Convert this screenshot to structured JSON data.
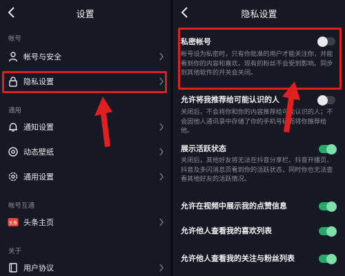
{
  "left": {
    "title": "设置",
    "sections": [
      {
        "label": "帐号"
      },
      {
        "label": "通用"
      },
      {
        "label": "帐号互通"
      },
      {
        "label": "关于"
      }
    ],
    "items": [
      {
        "label": "帐号与安全",
        "icon": "user-icon"
      },
      {
        "label": "隐私设置",
        "icon": "lock-icon"
      },
      {
        "label": "通知设置",
        "icon": "bell-icon"
      },
      {
        "label": "动态壁纸",
        "icon": "wallpaper-icon"
      },
      {
        "label": "通用设置",
        "icon": "gear-icon"
      },
      {
        "label": "头条主页",
        "icon": "toutiao-logo-icon",
        "badge": "头条"
      },
      {
        "label": "用户协议",
        "icon": "book-icon"
      }
    ]
  },
  "right": {
    "title": "隐私设置",
    "settings": [
      {
        "title": "私密帐号",
        "desc": "帐号设为私密时，只有你批准的用户才能关注你，并能看到你的内容和喜欢。现有的粉丝不会受到影响。同步到其他软件的开关会关闭。",
        "state": "off"
      },
      {
        "title": "允许将我推荐给可能认识的人",
        "desc": "关闭后，不会将你和你的内容推荐给可能认识的人；不会因他人通讯录中存储了你的手机号码而将你推荐给他。",
        "state": "off"
      },
      {
        "title": "展示活跃状态",
        "desc": "关闭后，其他好友将无法在抖音分享栏、抖音开播页、抖音及多闪消息页看到你的活跃状态，同时你也无法查看其他好友的活跃情况。",
        "state": "on"
      },
      {
        "title": "允许在视频中展示我的点赞信息",
        "state": "on"
      },
      {
        "title": "允许他人查看我的喜欢列表",
        "state": "on"
      },
      {
        "title": "允许他人查看我的关注与粉丝列表",
        "state": "on"
      }
    ]
  },
  "colors": {
    "highlight": "#e02020",
    "toggle_on": "#27a76b",
    "background": "#161823"
  }
}
